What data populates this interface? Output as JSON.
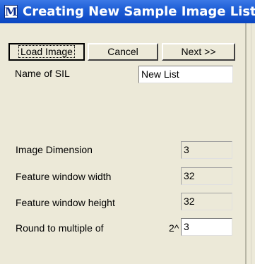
{
  "window": {
    "title": "Creating New Sample Image List",
    "icon_letter": "M"
  },
  "buttons": {
    "load": "Load Image",
    "cancel": "Cancel",
    "next": "Next >>"
  },
  "fields": {
    "name_of_sil": {
      "label": "Name of SIL",
      "value": "New List"
    },
    "image_dimension": {
      "label": "Image Dimension",
      "value": "3"
    },
    "feature_window_width": {
      "label": "Feature window width",
      "value": "32"
    },
    "feature_window_height": {
      "label": "Feature window height",
      "value": "32"
    },
    "round_to_multiple": {
      "label": "Round to multiple of",
      "prefix": "2^",
      "value": "3"
    }
  }
}
